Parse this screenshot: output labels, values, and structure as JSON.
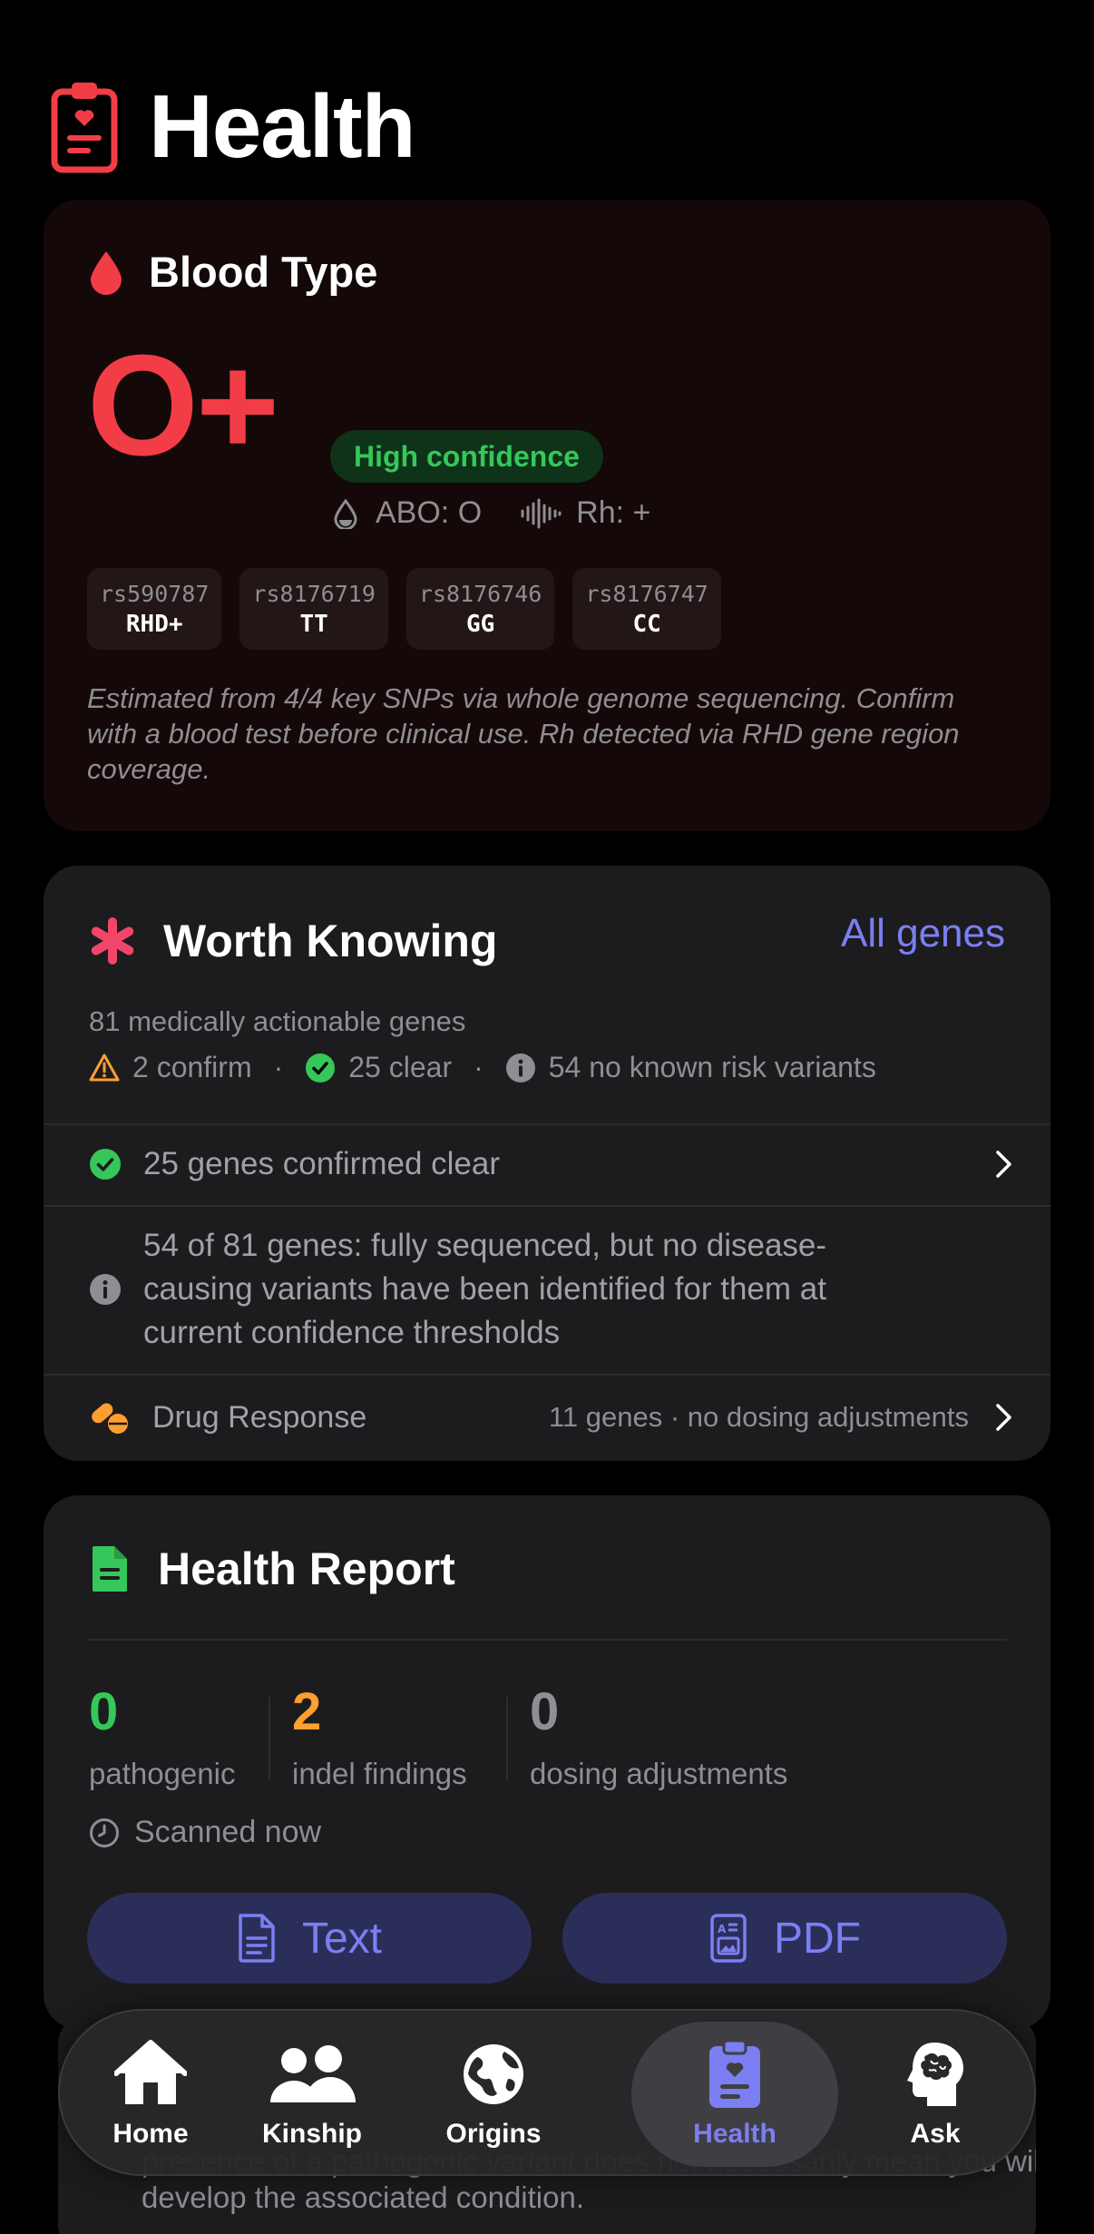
{
  "header": {
    "title": "Health"
  },
  "blood_type": {
    "title": "Blood Type",
    "value": "O+",
    "confidence": "High confidence",
    "abo": "ABO: O",
    "rh": "Rh: +",
    "snps": [
      {
        "id": "rs590787",
        "genotype": "RHD+"
      },
      {
        "id": "rs8176719",
        "genotype": "TT"
      },
      {
        "id": "rs8176746",
        "genotype": "GG"
      },
      {
        "id": "rs8176747",
        "genotype": "CC"
      }
    ],
    "note": "Estimated from 4/4 key SNPs via whole genome sequencing. Confirm with a blood test before clinical use. Rh detected via RHD gene region coverage."
  },
  "worth_knowing": {
    "title": "Worth Knowing",
    "link": "All genes",
    "subtitle": "81 medically actionable genes",
    "stat_confirm": "2 confirm",
    "stat_clear": "25 clear",
    "stat_no_risk": "54 no known risk variants",
    "dot": "·",
    "row_clear": "25 genes confirmed clear",
    "row_info": "54 of 81 genes: fully sequenced, but no disease-causing variants have been identified for them at current confidence thresholds",
    "drug_label": "Drug Response",
    "drug_value": "11 genes · no dosing adjustments"
  },
  "health_report": {
    "title": "Health Report",
    "stats": [
      {
        "value": "0",
        "label": "pathogenic",
        "color": "#35c759"
      },
      {
        "value": "2",
        "label": "indel findings",
        "color": "#ff9f2e"
      },
      {
        "value": "0",
        "label": "dosing adjustments",
        "color": "#8e8e93"
      }
    ],
    "scanned": "Scanned now",
    "btn_text": "Text",
    "btn_pdf": "PDF"
  },
  "peek": {
    "text": "presence of a pathogenic variant does not necessarily mean you will develop the associated condition."
  },
  "tabs": [
    {
      "label": "Home",
      "icon": "house-icon"
    },
    {
      "label": "Kinship",
      "icon": "people-icon"
    },
    {
      "label": "Origins",
      "icon": "globe-icon"
    },
    {
      "label": "Health",
      "icon": "clipboard-heart-icon",
      "active": true
    },
    {
      "label": "Ask",
      "icon": "brain-head-icon"
    }
  ],
  "colors": {
    "accent": "#7b7ff2",
    "red": "#f33d46",
    "green": "#35c759",
    "orange": "#ff9f2e"
  }
}
